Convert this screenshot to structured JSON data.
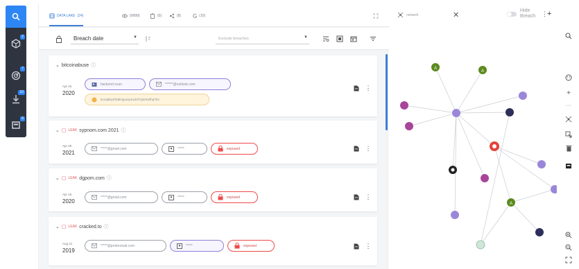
{
  "rail": {
    "badges": [
      "2",
      "7",
      "10",
      "6"
    ]
  },
  "tabs": [
    {
      "label": "DATA LAKE",
      "count": "(24)"
    },
    {
      "label": "",
      "count": "(9999)"
    },
    {
      "label": "",
      "count": "(0)"
    },
    {
      "label": "",
      "count": "(8)"
    },
    {
      "label": "",
      "count": "(10)"
    }
  ],
  "toolbar": {
    "sort_value": "Breach date",
    "filter_placeholder": "Exclude breaches"
  },
  "cards": [
    {
      "title": "bitcoinabuse",
      "tag": "",
      "date_md": "Apr 15",
      "date_year": "2020",
      "chips": [
        {
          "label": "backend scan",
          "style": "purple",
          "icon": "user-icon"
        },
        {
          "label": "******@outlook.com",
          "style": "purple",
          "icon": "mail-icon"
        },
        {
          "label": "bc1q9kp4rfa9tmjpuay4w3sf7dj4ckwfhq7h2",
          "style": "yellow",
          "icon": "bitcoin-icon"
        }
      ]
    },
    {
      "title": "sypnom.com 2021",
      "tag": "LEAK",
      "date_md": "Apr 29",
      "date_year": "2021",
      "chips": [
        {
          "label": "*****@gmail.com",
          "style": "plain",
          "icon": "mail-icon"
        },
        {
          "label": "*****",
          "style": "plain",
          "icon": "id-icon"
        },
        {
          "label": "exposed",
          "style": "red",
          "icon": "lock-icon"
        }
      ]
    },
    {
      "title": "dgpom.com",
      "tag": "LEAK",
      "date_md": "Apr 16",
      "date_year": "2020",
      "chips": [
        {
          "label": "*****@gmail.com",
          "style": "plain",
          "icon": "mail-icon"
        },
        {
          "label": "*****",
          "style": "plain",
          "icon": "id-icon"
        },
        {
          "label": "exposed",
          "style": "red",
          "icon": "lock-icon"
        }
      ]
    },
    {
      "title": "cracked.to",
      "tag": "LEAK",
      "date_md": "Aug 21",
      "date_year": "2019",
      "chips": [
        {
          "label": "*****@protonmail.com",
          "style": "plain",
          "icon": "mail-icon"
        },
        {
          "label": "*****",
          "style": "plain",
          "icon": "id-icon"
        },
        {
          "label": "exposed",
          "style": "red",
          "icon": "lock-icon"
        }
      ]
    }
  ],
  "graph": {
    "tab_label": "network",
    "hide_label_1": "Hide",
    "hide_label_2": "Breach"
  },
  "colors": {
    "accent": "#2e86f5",
    "rail_bg": "#2f3540",
    "node_green": "#5c8a1f",
    "node_purple": "#9b87d8",
    "node_magenta": "#a8459a",
    "node_red": "#e2453b",
    "node_navy": "#2c2f5a",
    "exposed_red": "#ef4a4a"
  }
}
